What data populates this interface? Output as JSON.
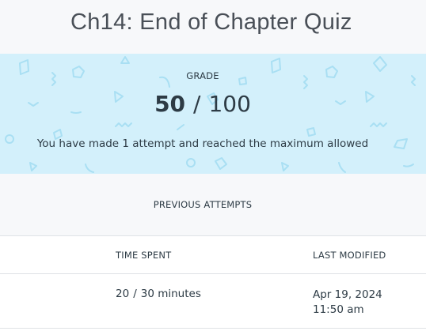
{
  "header": {
    "title": "Ch14: End of Chapter Quiz"
  },
  "grade": {
    "label": "GRADE",
    "earned": "50",
    "separator": "/",
    "total": "100",
    "attempts_message": "You have made 1 attempt and reached the maximum allowed"
  },
  "previous_attempts": {
    "heading": "PREVIOUS ATTEMPTS",
    "columns": {
      "time_spent": "TIME SPENT",
      "last_modified": "LAST MODIFIED"
    },
    "rows": [
      {
        "time_used": "20",
        "time_separator": "/",
        "time_limit": "30 minutes",
        "date": "Apr 19, 2024",
        "time": "11:50 am"
      }
    ]
  },
  "colors": {
    "grade_panel_bg": "#d3f0fb",
    "pattern_shape": "#a9dff3",
    "page_bg": "#f7f8fa",
    "text": "#2d3b45"
  }
}
